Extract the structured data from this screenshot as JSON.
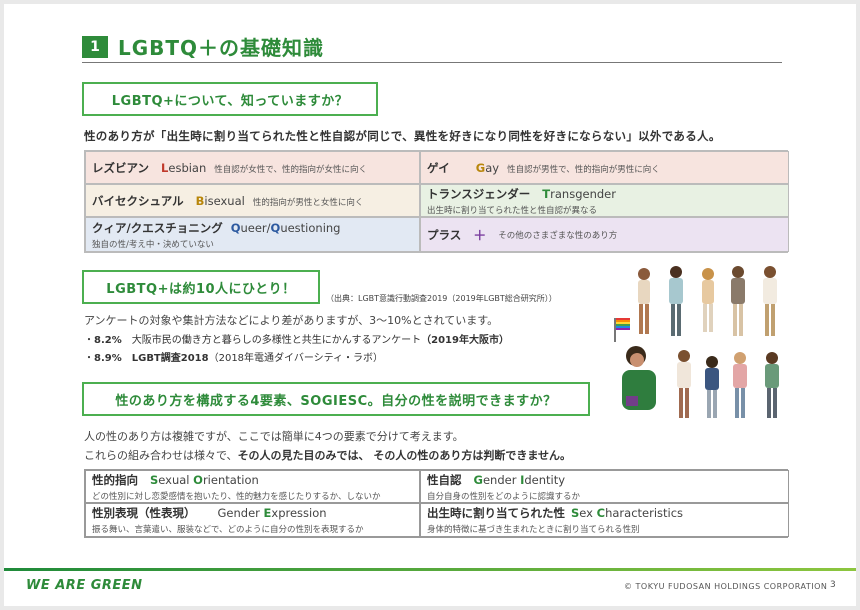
{
  "header": {
    "number": "1",
    "title": "LGBTQ＋の基礎知識"
  },
  "section1": {
    "heading": "LGBTQ+について、知っていますか？",
    "lead": "性のあり方が「出生時に割り当てられた性と性自認が同じで、異性を好きになり同性を好きにならない」以外である人。",
    "cells": [
      {
        "jp": "レズビアン",
        "initial": "L",
        "rest": "esbian",
        "desc": "性自認が女性で、性的指向が女性に向く"
      },
      {
        "jp": "ゲイ",
        "initial": "G",
        "rest": "ay",
        "desc": "性自認が男性で、性的指向が男性に向く"
      },
      {
        "jp": "バイセクシュアル",
        "initial": "B",
        "rest": "isexual",
        "desc": "性的指向が男性と女性に向く"
      },
      {
        "jp": "トランスジェンダー",
        "initial": "T",
        "rest": "ransgender",
        "desc": "出生時に割り当てられた性と性自認が異なる"
      },
      {
        "jp": "クィア/クエスチョニング",
        "initial": "Q",
        "rest": "ueer/",
        "initial2": "Q",
        "rest2": "uestioning",
        "desc": "独自の性/考え中・決めていない"
      },
      {
        "jp": "プラス",
        "symbol": "＋",
        "desc": "その他のさまざまな性のあり方"
      }
    ]
  },
  "section2": {
    "heading": "LGBTQ+は約10人にひとり！",
    "source": "（出典：LGBT意識行動調査2019（2019年LGBT総合研究所））",
    "text": "アンケートの対象や集計方法などにより差がありますが、3〜10%とされています。",
    "stats": [
      {
        "bullet": "・",
        "value": "8.2%",
        "label": "大阪市民の働き方と暮らしの多様性と共生にかんするアンケート",
        "year": "（2019年大阪市）"
      },
      {
        "bullet": "・",
        "value": "8.9%",
        "label": "LGBT調査2018",
        "year": "（2018年電通ダイバーシティ・ラボ）"
      }
    ]
  },
  "section3": {
    "heading": "性のあり方を構成する4要素、SOGIESC。自分の性を説明できますか？",
    "text1": "人の性のあり方は複雑ですが、ここでは簡単に4つの要素で分けて考えます。",
    "text2_pre": "これらの組み合わせは様々で、",
    "text2_bold": "その人の見た目のみでは、 その人の性のあり方は判断できません。",
    "cells": [
      {
        "jp": "性的指向",
        "i1": "S",
        "r1": "exual ",
        "i2": "O",
        "r2": "rientation",
        "desc": "どの性別に対し恋愛感情を抱いたり、性的魅力を感じたりするか、しないか"
      },
      {
        "jp": "性自認",
        "i1": "G",
        "r1": "ender ",
        "i2": "I",
        "r2": "dentity",
        "desc": "自分自身の性別をどのように認識するか"
      },
      {
        "jp": "性別表現（性表現）",
        "i1": "",
        "r1": "Gender ",
        "i2": "E",
        "r2": "xpression",
        "desc": "振る舞い、言葉遣い、服装などで、どのように自分の性別を表現するか"
      },
      {
        "jp": "出生時に割り当てられた性",
        "i1": "S",
        "r1": "ex ",
        "i2": "C",
        "r2": "haracteristics",
        "desc": "身体的特徴に基づき生まれたときに割り当てられる性別"
      }
    ]
  },
  "footer": {
    "brand": "WE ARE GREEN",
    "copyright": "© TOKYU FUDOSAN HOLDINGS CORPORATION",
    "page": "3"
  },
  "colors": {
    "accent": "#2e8b3a",
    "lesbian": "#c0392b",
    "gay": "#b8860b",
    "trans": "#2e8b3a",
    "queer": "#2d5aa0",
    "plus": "#7b3fa0"
  }
}
